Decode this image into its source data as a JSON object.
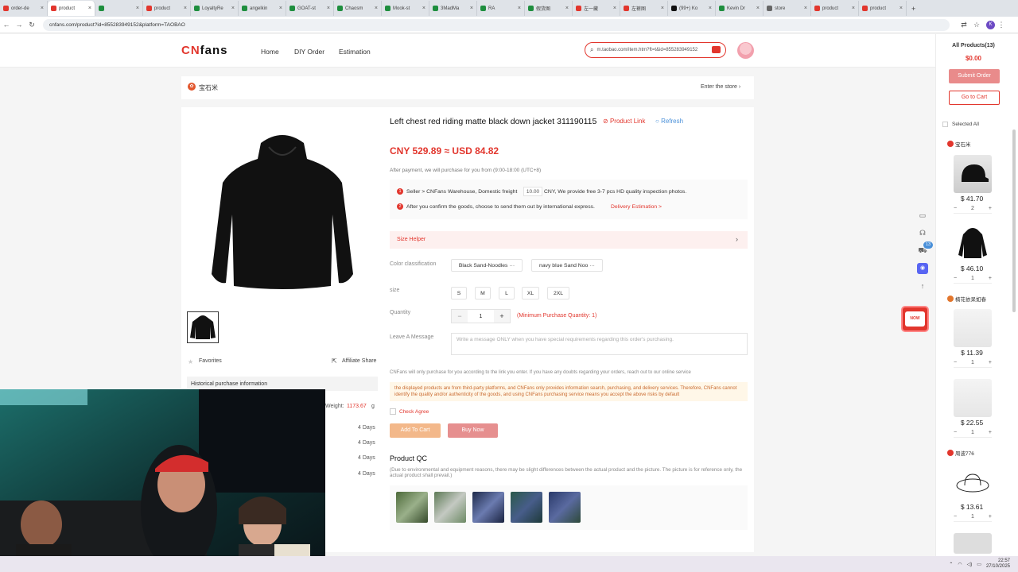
{
  "browser": {
    "tabs": [
      {
        "title": "order-de",
        "color": "#e2362d"
      },
      {
        "title": "product",
        "color": "#e2362d",
        "active": true
      },
      {
        "title": "",
        "color": "#1e8e3e"
      },
      {
        "title": "product",
        "color": "#e2362d"
      },
      {
        "title": "LoyaltyRe",
        "color": "#1e8e3e"
      },
      {
        "title": "angelkin",
        "color": "#1e8e3e"
      },
      {
        "title": "GOAT-st",
        "color": "#1e8e3e"
      },
      {
        "title": "Chaosm",
        "color": "#1e8e3e"
      },
      {
        "title": "Mook-st",
        "color": "#1e8e3e"
      },
      {
        "title": "3MadMa",
        "color": "#1e8e3e"
      },
      {
        "title": "RA",
        "color": "#1e8e3e"
      },
      {
        "title": "假货图",
        "color": "#1e8e3e"
      },
      {
        "title": "左一藏",
        "color": "#e2362d"
      },
      {
        "title": "左裤图",
        "color": "#e2362d"
      },
      {
        "title": "(99+) Ko",
        "color": "#111111"
      },
      {
        "title": "Kevin Dr",
        "color": "#1e8e3e"
      },
      {
        "title": "store",
        "color": "#666666"
      },
      {
        "title": "product",
        "color": "#e2362d"
      },
      {
        "title": "product",
        "color": "#e2362d"
      }
    ],
    "url": "cnfans.com/product?id=855283949152&platform=TAOBAO",
    "profile_initial": "K"
  },
  "header": {
    "logo_prefix": "CN",
    "logo_suffix": "fans",
    "nav": [
      "Home",
      "DIY Order",
      "Estimation"
    ],
    "search_value": "m.taobao.com/item.htm?ft=t&id=855283949152"
  },
  "shop": {
    "name": "宝石米",
    "enter_store": "Enter the store"
  },
  "product": {
    "title": "Left chest red riding matte black down jacket 311190115",
    "product_link": "Product Link",
    "refresh": "Refresh",
    "price": "CNY 529.89 ≈ USD 84.82",
    "after_payment": "After payment, we will purchase for you from (9:00-18:00 (UTC+8)",
    "step1_prefix": "Seller > CNFans Warehouse, Domestic freight",
    "step1_freight": "10.00",
    "step1_suffix": "CNY, We provide free 3-7 pcs HD quality inspection photos.",
    "step2_prefix": "After you confirm the goods, choose to send them out by international express.",
    "step2_link": "Delivery Estimation >",
    "size_helper": "Size Helper",
    "color_label": "Color classification",
    "colors": [
      "Black Sand-Noodles ···",
      "navy blue Sand Noo ···"
    ],
    "size_label": "size",
    "sizes": [
      "S",
      "M",
      "L",
      "XL",
      "2XL"
    ],
    "quantity_label": "Quantity",
    "quantity_value": "1",
    "min_qty": "(Minimum Purchase Quantity: 1)",
    "message_label": "Leave A Message",
    "message_placeholder": "Write a message ONLY when you have special requirements regarding this order's purchasing.",
    "notice": "CNFans will only purchase for you according to the link you enter. If you have any doubts regarding your orders, reach out to our online service",
    "disclaimer": "the displayed products are from third-party platforms, and CNFans only provides information search, purchasing, and delivery services. Therefore, CNFans cannot identify the quality and/or authenticity of the goods, and using CNFans purchasing service means you accept the above risks by default",
    "check_agree": "Check Agree",
    "add_to_cart": "Add To Cart",
    "buy_now": "Buy Now",
    "qc_title": "Product QC",
    "qc_note": "(Due to environmental and equipment reasons, there may be slight differences between the actual product and the picture. The picture is for reference only, the actual product shall prevail.)",
    "favorites": "Favorites",
    "affiliate_share": "Affiliate Share",
    "history_title": "Historical purchase information",
    "weight_label": "Weight:",
    "weight_value": "1173.67",
    "weight_unit": "g",
    "days": [
      "4 Days",
      "4 Days",
      "4 Days",
      "4 Days"
    ]
  },
  "cart": {
    "all_products": "All Products(13)",
    "total": "$0.00",
    "submit_order": "Submit Order",
    "go_to_cart": "Go to Cart",
    "selected_all": "Selected All",
    "store1": "宝石米",
    "store2": "楠花依呆如春",
    "store3": "周波776",
    "items": [
      {
        "price": "$ 41.70",
        "qty": "2"
      },
      {
        "price": "$ 46.10",
        "qty": "1"
      },
      {
        "price": "$ 11.39",
        "qty": "1"
      },
      {
        "price": "$ 22.55",
        "qty": "1"
      },
      {
        "price": "$ 13.61",
        "qty": "1"
      }
    ],
    "badge": "13"
  },
  "taskbar": {
    "time": "22:57",
    "date": "27/10/2025"
  },
  "colors": {
    "brand_red": "#e2362d",
    "submit_btn": "#e98b8b",
    "add_to_cart_btn": "#f3b88a",
    "buy_now_btn": "#e68f8f"
  }
}
